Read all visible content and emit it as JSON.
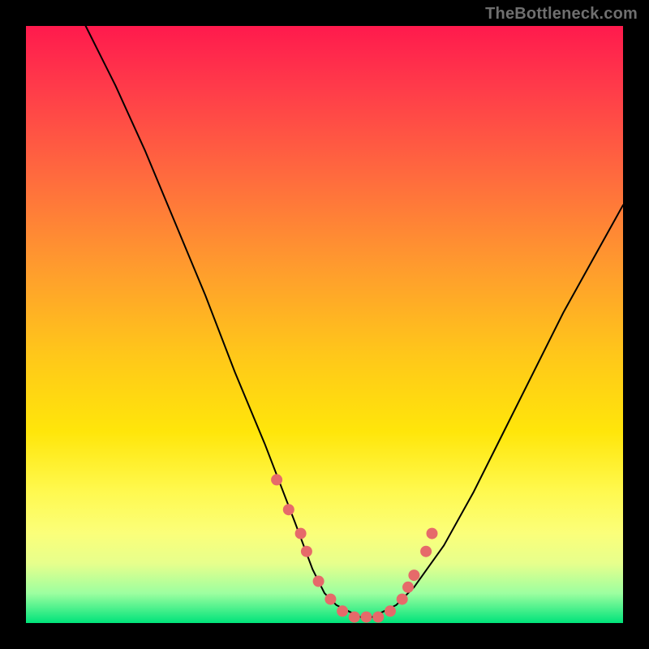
{
  "watermark": "TheBottleneck.com",
  "chart_data": {
    "type": "line",
    "title": "",
    "xlabel": "",
    "ylabel": "",
    "xlim": [
      0,
      100
    ],
    "ylim": [
      0,
      100
    ],
    "grid": false,
    "legend": false,
    "series": [
      {
        "name": "bottleneck-curve",
        "x": [
          10,
          15,
          20,
          25,
          30,
          35,
          40,
          45,
          48,
          50,
          52,
          54,
          56,
          58,
          60,
          62,
          65,
          70,
          75,
          80,
          85,
          90,
          95,
          100
        ],
        "y": [
          100,
          90,
          79,
          67,
          55,
          42,
          30,
          17,
          9,
          5,
          3,
          2,
          1,
          1,
          2,
          3,
          6,
          13,
          22,
          32,
          42,
          52,
          61,
          70
        ]
      }
    ],
    "markers": {
      "name": "highlighted-points",
      "x": [
        42,
        44,
        46,
        47,
        49,
        51,
        53,
        55,
        57,
        59,
        61,
        63,
        64,
        65,
        67,
        68
      ],
      "y": [
        24,
        19,
        15,
        12,
        7,
        4,
        2,
        1,
        1,
        1,
        2,
        4,
        6,
        8,
        12,
        15
      ]
    }
  }
}
